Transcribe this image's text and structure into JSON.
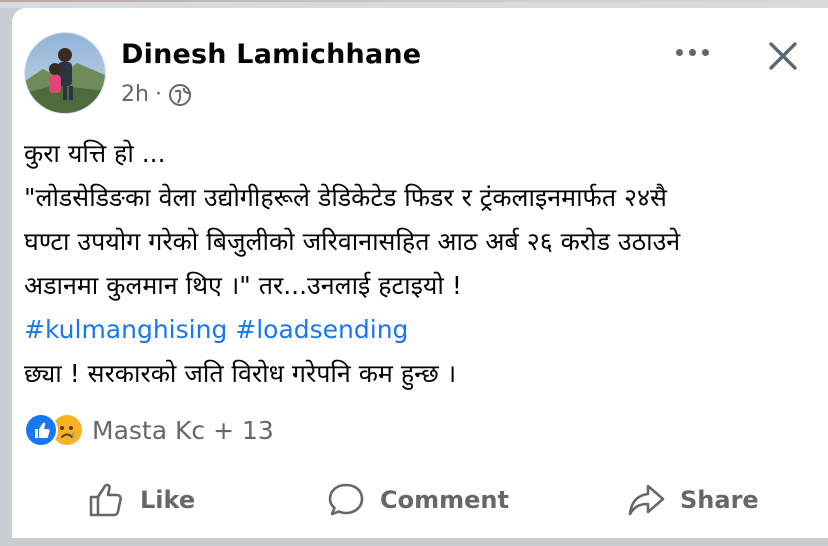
{
  "post": {
    "author": "Dinesh Lamichhane",
    "time": "2h",
    "separator": "·",
    "privacy_icon": "globe-icon",
    "lines": [
      "कुरा यत्ति हाे ...",
      "\"लोडसेडिङका वेला उद्योगीहरूले डेडिकेटेड फिडर र ट्रंकलाइनमार्फत २४सै",
      "घण्टा उपयोग गरेको बिजुलीको जरिवानासहित आठ अर्ब २६ करोड उठाउने",
      "अडानमा कुलमान थिए ।\" तर...उनलाई हटाइयाे !"
    ],
    "hashtags": [
      "#kulmanghising",
      "#loadsending"
    ],
    "last_line": "छ्या ! सरकारकाे जति विराेध गरेपनि कम हुन्छ ।"
  },
  "reactions": {
    "icons": [
      "like-icon",
      "sad-icon"
    ],
    "text": "Masta Kc + 13"
  },
  "actions": {
    "like": "Like",
    "comment": "Comment",
    "share": "Share"
  },
  "colors": {
    "link": "#1877f2",
    "secondary_text": "#65676b",
    "background": "#ffffff"
  }
}
